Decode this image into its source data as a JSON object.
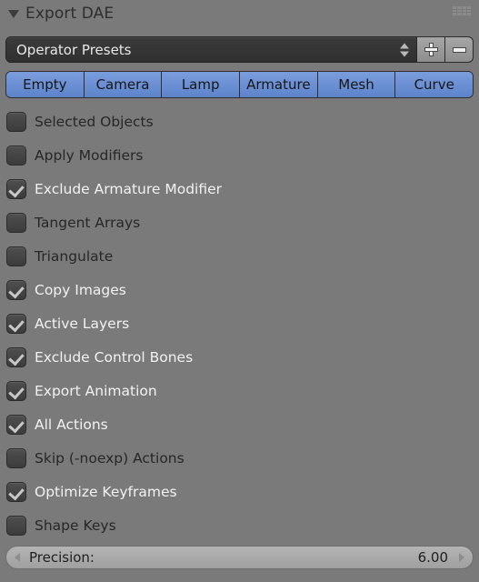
{
  "panel": {
    "title": "Export DAE",
    "collapse_icon": "triangle-down-icon",
    "grip_icon": "grip-dots-icon"
  },
  "preset": {
    "value": "Operator Presets",
    "spinner_icon": "up-down-arrows-icon",
    "add_label": "+",
    "remove_label": "–"
  },
  "tabs": [
    {
      "label": "Empty"
    },
    {
      "label": "Camera"
    },
    {
      "label": "Lamp"
    },
    {
      "label": "Armature"
    },
    {
      "label": "Mesh"
    },
    {
      "label": "Curve"
    }
  ],
  "options": [
    {
      "label": "Selected Objects",
      "checked": false
    },
    {
      "label": "Apply Modifiers",
      "checked": false
    },
    {
      "label": "Exclude Armature Modifier",
      "checked": true
    },
    {
      "label": "Tangent Arrays",
      "checked": false
    },
    {
      "label": "Triangulate",
      "checked": false
    },
    {
      "label": "Copy Images",
      "checked": true
    },
    {
      "label": "Active Layers",
      "checked": true
    },
    {
      "label": "Exclude Control Bones",
      "checked": true
    },
    {
      "label": "Export Animation",
      "checked": true
    },
    {
      "label": "All Actions",
      "checked": true
    },
    {
      "label": "Skip (-noexp) Actions",
      "checked": false
    },
    {
      "label": "Optimize Keyframes",
      "checked": true
    },
    {
      "label": "Shape Keys",
      "checked": false
    }
  ],
  "precision": {
    "label": "Precision:",
    "value": "6.00",
    "dec_icon": "arrow-left-icon",
    "inc_icon": "arrow-right-icon"
  },
  "colors": {
    "background": "#7a7a7a",
    "tab_active": "#6a91d4",
    "field_dark": "#353535",
    "text_dark": "#272727",
    "text_light": "#f2f2f2"
  }
}
